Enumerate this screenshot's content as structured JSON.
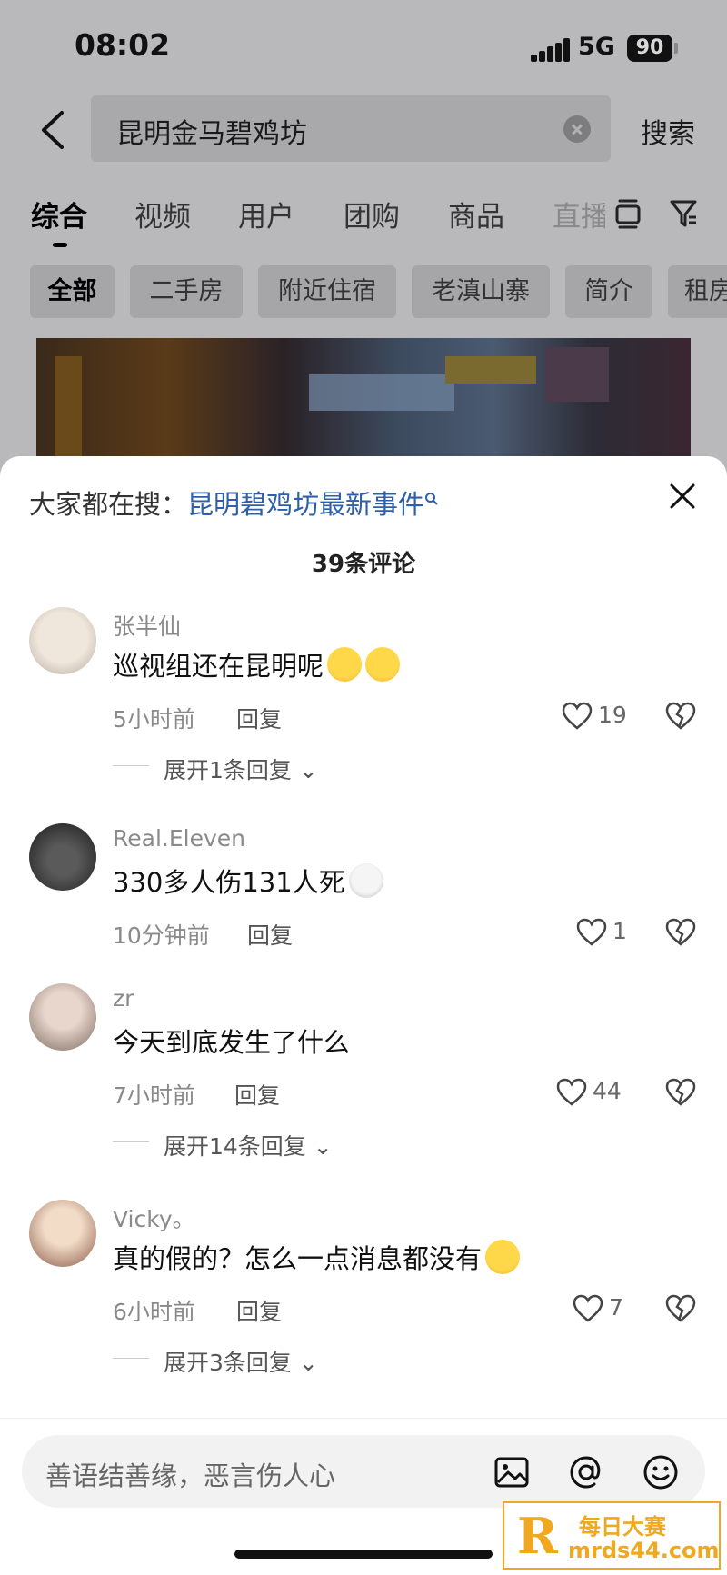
{
  "status_bar": {
    "time": "08:02",
    "network": "5G",
    "battery": "90"
  },
  "search": {
    "query": "昆明金马碧鸡坊",
    "submit_label": "搜索"
  },
  "tabs": [
    {
      "label": "综合",
      "active": true
    },
    {
      "label": "视频"
    },
    {
      "label": "用户"
    },
    {
      "label": "团购"
    },
    {
      "label": "商品"
    },
    {
      "label": "直播"
    }
  ],
  "chips": [
    {
      "label": "全部",
      "active": true
    },
    {
      "label": "二手房"
    },
    {
      "label": "附近住宿"
    },
    {
      "label": "老滇山寨"
    },
    {
      "label": "简介"
    },
    {
      "label": "租房"
    }
  ],
  "sheet": {
    "suggest_prefix": "大家都在搜：",
    "suggest_link": "昆明碧鸡坊最新事件",
    "comment_count": "39条评论"
  },
  "comments": [
    {
      "user": "张半仙",
      "text": "巡视组还在昆明呢",
      "emoji": [
        "laughing-emoji",
        "laughing-emoji"
      ],
      "time": "5小时前",
      "reply": "回复",
      "likes": "19",
      "expand": "展开1条回复"
    },
    {
      "user": "Real.Eleven",
      "text": "330多人伤131人死",
      "emoji": [
        "shocked-emoji"
      ],
      "time": "10分钟前",
      "reply": "回复",
      "likes": "1",
      "expand": ""
    },
    {
      "user": "zr",
      "text": "今天到底发生了什么",
      "emoji": [],
      "time": "7小时前",
      "reply": "回复",
      "likes": "44",
      "expand": "展开14条回复"
    },
    {
      "user": "Vicky。",
      "text": "真的假的？怎么一点消息都没有",
      "emoji": [
        "crying-emoji"
      ],
      "time": "6小时前",
      "reply": "回复",
      "likes": "7",
      "expand": "展开3条回复"
    }
  ],
  "input": {
    "placeholder": "善语结善缘，恶言伤人心"
  },
  "watermark": {
    "line1": "每日大赛",
    "line2": "mrds44.com",
    "logo_letter": "R"
  },
  "colors": {
    "accent_link": "#2f5fa8",
    "watermark": "#f0a820"
  }
}
